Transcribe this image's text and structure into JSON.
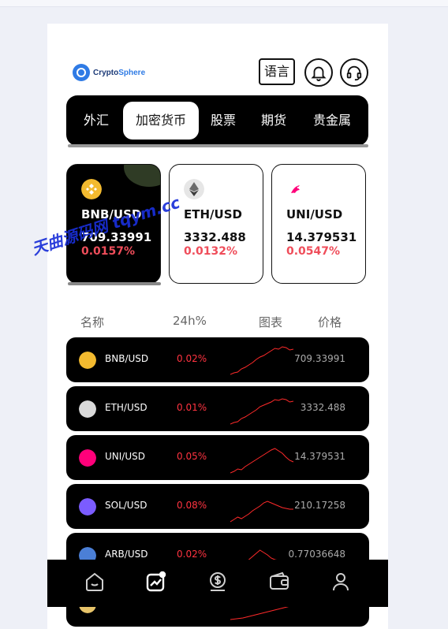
{
  "header": {
    "logo_text_1": "Crypto",
    "logo_text_2": "Sphere",
    "lang_label": "语言"
  },
  "tabs": [
    {
      "label": "外汇",
      "active": false
    },
    {
      "label": "加密货币",
      "active": true
    },
    {
      "label": "股票",
      "active": false
    },
    {
      "label": "期货",
      "active": false
    },
    {
      "label": "贵金属",
      "active": false
    }
  ],
  "cards": [
    {
      "pair": "BNB/USD",
      "price": "709.33991",
      "change": "0.0157%",
      "icon": "bnb-icon",
      "color": "#f3ba2f"
    },
    {
      "pair": "ETH/USD",
      "price": "3332.488",
      "change": "0.0132%",
      "icon": "eth-icon",
      "color": "#8a8a8a"
    },
    {
      "pair": "UNI/USD",
      "price": "14.379531",
      "change": "0.0547%",
      "icon": "uni-icon",
      "color": "#ff007a"
    }
  ],
  "list_header": {
    "name": "名称",
    "change": "24h%",
    "chart": "图表",
    "price": "价格"
  },
  "rows": [
    {
      "pair": "BNB/USD",
      "change": "0.02%",
      "price": "709.33991",
      "icon": "bnb-icon",
      "color": "#f3ba2f",
      "spark": [
        3,
        5,
        6,
        10,
        12,
        15,
        18,
        22,
        25,
        27,
        30,
        33,
        36,
        35,
        38,
        37,
        34,
        35
      ]
    },
    {
      "pair": "ETH/USD",
      "change": "0.01%",
      "price": "3332.488",
      "icon": "eth-icon",
      "color": "#d9d9d9",
      "spark": [
        2,
        4,
        5,
        9,
        11,
        14,
        17,
        20,
        24,
        26,
        28,
        30,
        33,
        32,
        34,
        33,
        30,
        31
      ]
    },
    {
      "pair": "UNI/USD",
      "change": "0.05%",
      "price": "14.379531",
      "icon": "uni-icon",
      "color": "#ff007a",
      "spark": [
        2,
        4,
        7,
        6,
        10,
        13,
        16,
        19,
        22,
        25,
        28,
        31,
        33,
        30,
        27,
        22,
        18,
        16
      ]
    },
    {
      "pair": "SOL/USD",
      "change": "0.08%",
      "price": "210.17258",
      "icon": "sol-icon",
      "color": "#7b5cff",
      "spark": [
        2,
        5,
        8,
        6,
        9,
        12,
        16,
        19,
        22,
        26,
        28,
        26,
        24,
        22,
        20,
        19,
        18,
        18
      ]
    },
    {
      "pair": "ARB/USD",
      "change": "0.02%",
      "price": "0.77036648",
      "icon": "arb-icon",
      "color": "#4b7fd6",
      "spark": [
        2,
        4,
        6,
        8,
        12,
        16,
        20,
        24,
        28,
        25,
        22,
        18,
        16,
        15,
        14,
        14,
        13,
        13
      ]
    },
    {
      "pair": "",
      "change": "",
      "price": "",
      "icon": "coin-icon",
      "color": "#e8c46a",
      "spark": [
        2,
        4,
        8,
        12,
        16,
        20
      ]
    }
  ],
  "watermark": "天曲源码网 tqym.cc",
  "bottom_nav": [
    {
      "icon": "home-icon"
    },
    {
      "icon": "market-icon",
      "active": true
    },
    {
      "icon": "dollar-icon"
    },
    {
      "icon": "wallet-icon"
    },
    {
      "icon": "user-icon"
    }
  ],
  "colors": {
    "negative": "#ef4d5a",
    "row_change": "#ff3340",
    "spark_line": "#ff2a2a",
    "surface": "#000000"
  }
}
